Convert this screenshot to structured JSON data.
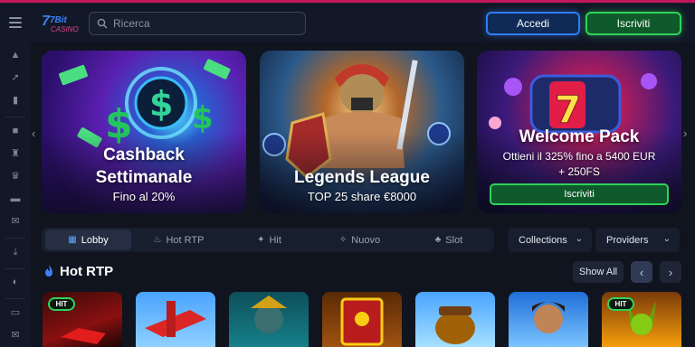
{
  "header": {
    "search_placeholder": "Ricerca",
    "login_label": "Accedi",
    "register_label": "Iscriviti"
  },
  "logo": {
    "text_top": "7Bit",
    "text_bottom": "CASINO"
  },
  "banners": [
    {
      "title_line1": "Cashback",
      "title_line2": "Settimanale",
      "subtitle": "Fino al 20%"
    },
    {
      "title": "Legends League",
      "subtitle": "TOP 25 share €8000"
    },
    {
      "title": "Welcome Pack",
      "subtitle_line1": "Ottieni il 325% fino a 5400 EUR",
      "subtitle_line2": "+ 250FS",
      "button_label": "Iscriviti"
    }
  ],
  "tabs": [
    {
      "label": "Lobby",
      "icon": "lobby-icon",
      "active": true
    },
    {
      "label": "Hot RTP",
      "icon": "flame-icon"
    },
    {
      "label": "Hit",
      "icon": "hit-icon"
    },
    {
      "label": "Nuovo",
      "icon": "new-icon"
    },
    {
      "label": "Slot",
      "icon": "slot-icon"
    }
  ],
  "filters": {
    "collections": "Collections",
    "providers": "Providers"
  },
  "section": {
    "title": "Hot RTP",
    "show_all": "Show All"
  },
  "games": [
    {
      "badge": "HIT"
    },
    {
      "badge": ""
    },
    {
      "badge": ""
    },
    {
      "badge": ""
    },
    {
      "badge": ""
    },
    {
      "badge": ""
    },
    {
      "badge": "HIT"
    }
  ],
  "colors": {
    "accent_blue": "#2f7df6",
    "accent_green": "#2fd35a",
    "background": "#10141f"
  }
}
